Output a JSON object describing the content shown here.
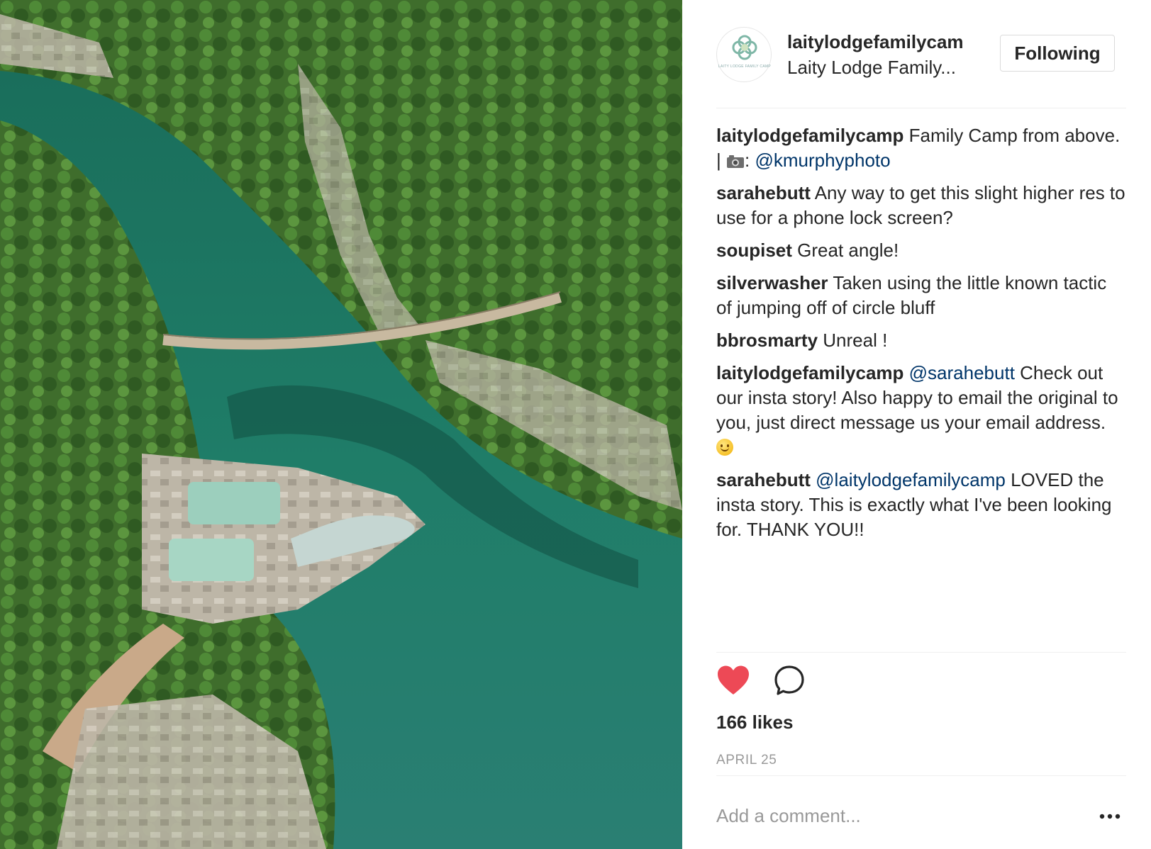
{
  "post": {
    "photo": {
      "alt_icon": "photo-river-canyon",
      "colors": {
        "water": "#1d7463",
        "trees": "#3d6b2a",
        "rock": "#c9c2b4"
      }
    },
    "header": {
      "username": "laitylodgefamilycam",
      "full_name": "Laity Lodge Family...",
      "avatar_text": "LAITY LODGE FAMILY CAMP",
      "follow_label": "Following"
    },
    "caption": {
      "user": "laitylodgefamilycamp",
      "text": " Family Camp from above. | ",
      "camera_icon": "camera-icon",
      "colon": ": ",
      "mention": "@kmurphyphoto"
    },
    "comments": [
      {
        "user": "sarahebutt",
        "mention": "",
        "text": " Any way to get this slight higher res to use for a phone lock screen?"
      },
      {
        "user": "soupiset",
        "mention": "",
        "text": " Great angle!"
      },
      {
        "user": "silverwasher",
        "mention": "",
        "text": " Taken using the little known tactic of jumping off of circle bluff"
      },
      {
        "user": "bbrosmarty",
        "mention": "",
        "text": " Unreal !"
      },
      {
        "user": "laitylodgefamilycamp",
        "mention": "@sarahebutt",
        "text": " Check out our insta story! Also happy to email the original to you, just direct message us your email address. ",
        "emoji": "smile-emoji"
      },
      {
        "user": "sarahebutt",
        "mention": "@laitylodgefamilycamp",
        "text": " LOVED the insta story. This is exactly what I've been looking for. THANK YOU!!"
      }
    ],
    "likes": "166 likes",
    "date": "APRIL 25",
    "add_comment_placeholder": "Add a comment...",
    "colors": {
      "heart": "#ed4956",
      "mention": "#003569",
      "muted": "#999999"
    }
  }
}
